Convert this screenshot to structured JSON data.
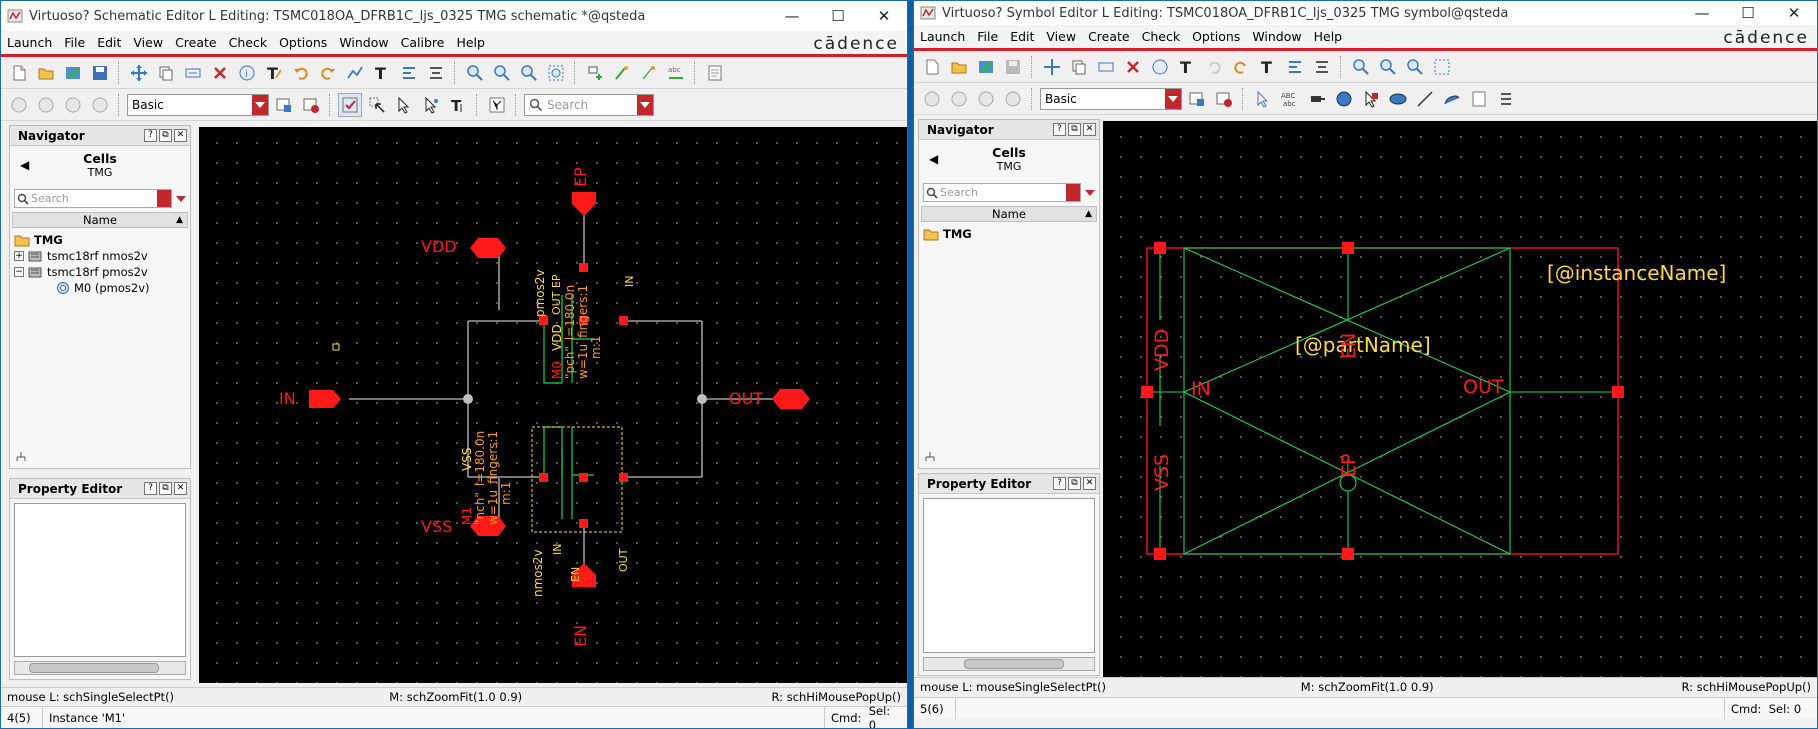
{
  "left_window": {
    "title": "Virtuoso? Schematic Editor L Editing: TSMC018OA_DFRB1C_ljs_0325 TMG schematic *@qsteda",
    "menus": [
      "Launch",
      "File",
      "Edit",
      "View",
      "Create",
      "Check",
      "Options",
      "Window",
      "Calibre",
      "Help"
    ],
    "logo": "cādence",
    "combo_value": "Basic",
    "search_placeholder": "Search",
    "navigator": {
      "title": "Navigator",
      "cells_label": "Cells",
      "cells_sub": "TMG",
      "search_placeholder": "Search",
      "col_header": "Name",
      "tree": [
        {
          "label": "TMG",
          "level": 0
        },
        {
          "label": "tsmc18rf nmos2v",
          "level": 1
        },
        {
          "label": "tsmc18rf pmos2v",
          "level": 1
        },
        {
          "label": "M0 (pmos2v)",
          "level": 2
        }
      ]
    },
    "property_editor": {
      "title": "Property Editor"
    },
    "schematic": {
      "pins": {
        "ep": "EP",
        "vdd": "VDD",
        "in": "IN",
        "out": "OUT",
        "vss": "VSS",
        "en": "EN"
      },
      "m0": {
        "model": "pmos2v",
        "name": "M0",
        "type": "\"pch\"",
        "w": "w=1u",
        "l": "l=180.0n",
        "fingers": "fingers:1",
        "m": "m:1",
        "t_out": "OUT",
        "t_ep": "EP",
        "t_vdd": "VDD",
        "t_in": "IN"
      },
      "m1": {
        "model": "nmos2v",
        "name": "M1",
        "type": "\"nch\"",
        "w": "w=1u",
        "l": "l=180.0n",
        "fingers": "fingers:1",
        "m": "m:1",
        "t_in": "IN",
        "t_vss": "VSS",
        "t_out": "OUT",
        "t_en": "EN"
      }
    },
    "status_mouse_l": "mouse L: schSingleSelectPt()",
    "status_mouse_m": "M: schZoomFit(1.0 0.9)",
    "status_mouse_r": "R: schHiMousePopUp()",
    "status_count": "4(5)",
    "status_msg": "Instance 'M1'",
    "status_cmd": "Cmd:",
    "status_sel": "Sel: 0"
  },
  "right_window": {
    "title": "Virtuoso? Symbol Editor L Editing: TSMC018OA_DFRB1C_ljs_0325 TMG symbol@qsteda",
    "menus": [
      "Launch",
      "File",
      "Edit",
      "View",
      "Create",
      "Check",
      "Options",
      "Window",
      "Help"
    ],
    "logo": "cādence",
    "combo_value": "Basic",
    "navigator": {
      "title": "Navigator",
      "cells_label": "Cells",
      "cells_sub": "TMG",
      "search_placeholder": "Search",
      "col_header": "Name",
      "tree": [
        {
          "label": "TMG",
          "level": 0
        }
      ]
    },
    "property_editor": {
      "title": "Property Editor"
    },
    "symbol": {
      "instance_name": "[@instanceName]",
      "part_name": "[@partName]",
      "vdd": "VDD",
      "vss": "VSS",
      "in": "IN",
      "out": "OUT",
      "en": "EN",
      "ep": "EP"
    },
    "status_mouse_l": "mouse L: mouseSingleSelectPt()",
    "status_mouse_m": "M: schZoomFit(1.0 0.9)",
    "status_mouse_r": "R: schHiMousePopUp()",
    "status_count": "5(6)",
    "status_cmd": "Cmd:",
    "status_sel": "Sel: 0"
  },
  "colors": {
    "wire": "#c0c0c0",
    "pin": "#ff1a1a",
    "device": "#21d24a",
    "label": "#ff9a1a",
    "attr": "#ffd84a",
    "accent": "#d42025"
  }
}
